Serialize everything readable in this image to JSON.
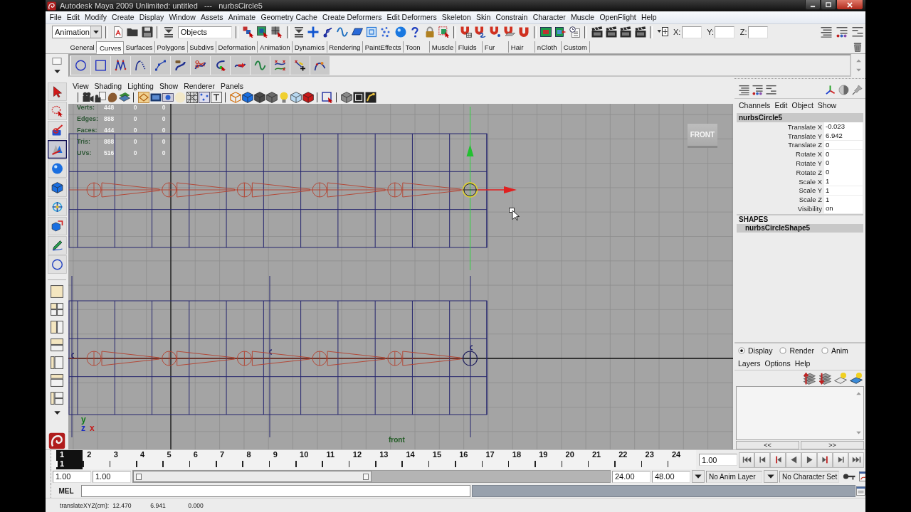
{
  "window": {
    "title": "Autodesk Maya 2009 Unlimited: untitled   ---   nurbsCircle5"
  },
  "menu_bar": [
    "File",
    "Edit",
    "Modify",
    "Create",
    "Display",
    "Window",
    "Assets",
    "Animate",
    "Geometry Cache",
    "Create Deformers",
    "Edit Deformers",
    "Skeleton",
    "Skin",
    "Constrain",
    "Character",
    "Muscle",
    "OpenFlight",
    "Help"
  ],
  "status_line": {
    "menu_set": "Animation",
    "selection_mask": "Objects",
    "coordinate_labels": [
      "X:",
      "Y:",
      "Z:"
    ]
  },
  "shelf_tabs": [
    {
      "label": "General",
      "selected": false
    },
    {
      "label": "Curves",
      "selected": true
    },
    {
      "label": "Surfaces",
      "selected": false
    },
    {
      "label": "Polygons",
      "selected": false
    },
    {
      "label": "Subdivs",
      "selected": false
    },
    {
      "label": "Deformation",
      "selected": false
    },
    {
      "label": "Animation",
      "selected": false
    },
    {
      "label": "Dynamics",
      "selected": false
    },
    {
      "label": "Rendering",
      "selected": false
    },
    {
      "label": "PaintEffects",
      "selected": false
    },
    {
      "label": "Toon",
      "selected": false
    },
    {
      "label": "Muscle",
      "selected": false
    },
    {
      "label": "Fluids",
      "selected": false
    },
    {
      "label": "Fur",
      "selected": false
    },
    {
      "label": "Hair",
      "selected": false
    },
    {
      "label": "nCloth",
      "selected": false
    },
    {
      "label": "Custom",
      "selected": false
    }
  ],
  "toolbox": [
    {
      "kind": "select",
      "selected": false
    },
    {
      "kind": "lasso",
      "selected": false
    },
    {
      "kind": "paint",
      "selected": false
    },
    {
      "kind": "move",
      "selected": true
    },
    {
      "kind": "rotate",
      "selected": false
    },
    {
      "kind": "scale",
      "selected": false
    },
    {
      "kind": "manipulator",
      "selected": false
    },
    {
      "kind": "soft_modify",
      "selected": false
    },
    {
      "kind": "sculpt",
      "selected": false
    },
    {
      "kind": "circle",
      "selected": false
    }
  ],
  "viewport": {
    "menus": [
      "View",
      "Shading",
      "Lighting",
      "Show",
      "Renderer",
      "Panels"
    ],
    "hud": [
      {
        "label": "Verts:",
        "values": [
          "448",
          "0",
          "0"
        ]
      },
      {
        "label": "Edges:",
        "values": [
          "888",
          "0",
          "0"
        ]
      },
      {
        "label": "Faces:",
        "values": [
          "444",
          "0",
          "0"
        ]
      },
      {
        "label": "Tris:",
        "values": [
          "888",
          "0",
          "0"
        ]
      },
      {
        "label": "UVs:",
        "values": [
          "516",
          "0",
          "0"
        ]
      }
    ],
    "view_cube_label": "FRONT",
    "axis_labels": [
      {
        "label": "y",
        "color": "#0e7a18"
      },
      {
        "label": "z",
        "color": "#1a2ac0"
      },
      {
        "label": "x",
        "color": "#c41a1a"
      }
    ],
    "camera_label": "front"
  },
  "channel_box": {
    "menus": [
      "Channels",
      "Edit",
      "Object",
      "Show"
    ],
    "object_name": "nurbsCircle5",
    "attributes": [
      {
        "name": "Translate X",
        "value": "-0.023"
      },
      {
        "name": "Translate Y",
        "value": "6.942"
      },
      {
        "name": "Translate Z",
        "value": "0"
      },
      {
        "name": "Rotate X",
        "value": "0"
      },
      {
        "name": "Rotate Y",
        "value": "0"
      },
      {
        "name": "Rotate Z",
        "value": "0"
      },
      {
        "name": "Scale X",
        "value": "1"
      },
      {
        "name": "Scale Y",
        "value": "1"
      },
      {
        "name": "Scale Z",
        "value": "1"
      },
      {
        "name": "Visibility",
        "value": "on"
      }
    ],
    "shapes_heading": "SHAPES",
    "shapes": [
      {
        "name": "nurbsCircleShape5",
        "selected": true
      }
    ]
  },
  "layer_editor": {
    "modes": [
      {
        "label": "Display",
        "selected": true
      },
      {
        "label": "Render",
        "selected": false
      },
      {
        "label": "Anim",
        "selected": false
      }
    ],
    "menus": [
      "Layers",
      "Options",
      "Help"
    ],
    "pager": [
      "<<",
      ">>"
    ]
  },
  "time_slider": {
    "frames": [
      {
        "label": "1",
        "selected": true
      },
      {
        "label": "2",
        "selected": false
      },
      {
        "label": "3",
        "selected": false
      },
      {
        "label": "4",
        "selected": false
      },
      {
        "label": "5",
        "selected": false
      },
      {
        "label": "6",
        "selected": false
      },
      {
        "label": "7",
        "selected": false
      },
      {
        "label": "8",
        "selected": false
      },
      {
        "label": "9",
        "selected": false
      },
      {
        "label": "10",
        "selected": false
      },
      {
        "label": "11",
        "selected": false
      },
      {
        "label": "12",
        "selected": false
      },
      {
        "label": "13",
        "selected": false
      },
      {
        "label": "14",
        "selected": false
      },
      {
        "label": "15",
        "selected": false
      },
      {
        "label": "16",
        "selected": false
      },
      {
        "label": "17",
        "selected": false
      },
      {
        "label": "18",
        "selected": false
      },
      {
        "label": "19",
        "selected": false
      },
      {
        "label": "20",
        "selected": false
      },
      {
        "label": "21",
        "selected": false
      },
      {
        "label": "22",
        "selected": false
      },
      {
        "label": "23",
        "selected": false
      },
      {
        "label": "24",
        "selected": false
      }
    ],
    "current_frame": "1",
    "current_time": "1.00"
  },
  "range_slider": {
    "start_time": "1.00",
    "playback_start": "1.00",
    "playback_end": "24.00",
    "end_time": "48.00",
    "level": 0.5
  },
  "anim_layer": "No Anim Layer",
  "character_set": "No Character Set",
  "command_line": {
    "language": "MEL"
  },
  "help_line": {
    "label": "translateXYZ(cm):",
    "values": [
      "12.470",
      "6.941",
      "0.000"
    ]
  }
}
